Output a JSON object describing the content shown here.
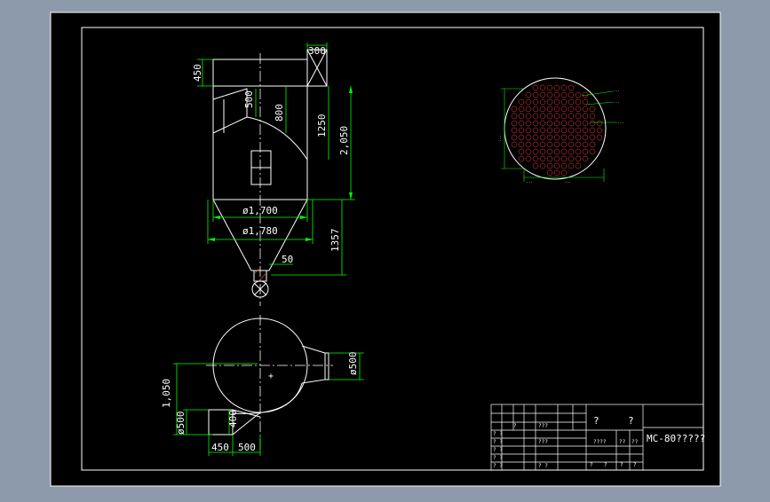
{
  "colors": {
    "app_background": "#8d9aab",
    "sheet": "#000000",
    "outline": "#ffffff",
    "dimension": "#00ff00",
    "hatch": "#ff0000",
    "center_line": "#ffffff"
  },
  "drawing": {
    "dimensions": {
      "d300": "300",
      "d450_top": "450",
      "d500_inlet": "500",
      "d800": "800",
      "d1250": "1250",
      "d2050": "2,050",
      "d1700": "ø1,700",
      "d1780": "ø1,780",
      "d1357": "1357",
      "d50": "50",
      "d500_outlet": "ø500",
      "d1050": "1,050",
      "d500_left": "ø500",
      "d400": "400",
      "d450_bottom": "450",
      "d500_bottom": "500"
    },
    "detail_labels": {
      "left": "...",
      "top1": "...",
      "top2": "...",
      "right": "...",
      "bottom1": "...",
      "bottom2": "..."
    }
  },
  "title_block": {
    "title": "MC-80?????",
    "q1": "?",
    "q2": "?",
    "r1": "????",
    "r2": "???",
    "r3": "???",
    "r4": "??",
    "r5": "??",
    "s1": "?",
    "s2": "?",
    "s3": "?",
    "s4": "?",
    "s5": "?",
    "s6": "? ?",
    "s7": "? ?",
    "s8": "? ?",
    "s9": "? ?",
    "s10": "? ?",
    "s11": "? ?"
  }
}
